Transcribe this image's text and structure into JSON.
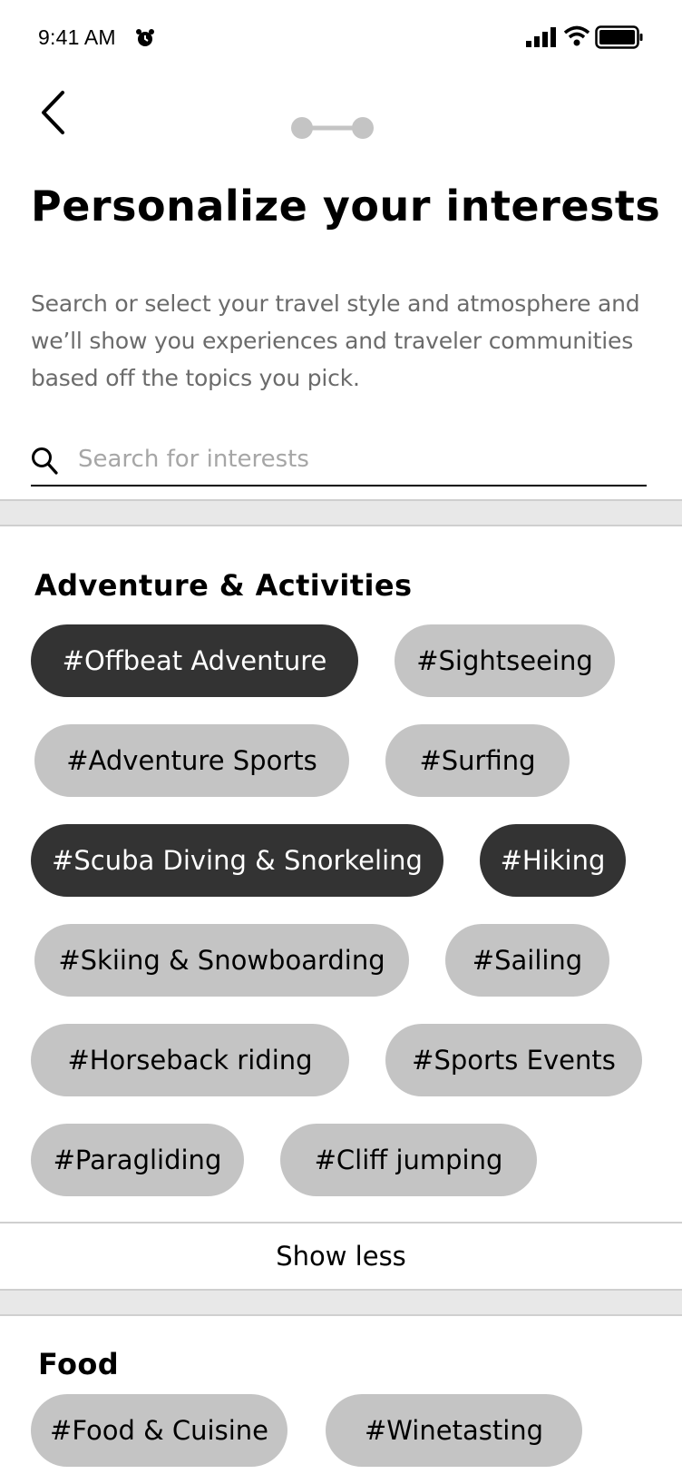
{
  "status_bar": {
    "time": "9:41 AM",
    "icons": [
      "alarm-icon",
      "signal-icon",
      "wifi-icon",
      "battery-icon"
    ]
  },
  "nav": {
    "back_icon": "chevron-left-icon",
    "progress_steps": 2
  },
  "header": {
    "title": "Personalize your interests",
    "description": "Search or select your travel style and atmosphere and we’ll show you experiences and traveler communities based off the topics you pick."
  },
  "search": {
    "placeholder": "Search for interests",
    "value": ""
  },
  "sections": [
    {
      "title": "Adventure & Activities",
      "chips": [
        {
          "label": "#Offbeat Adventure",
          "selected": true
        },
        {
          "label": "#Sightseeing",
          "selected": false
        },
        {
          "label": "#Adventure Sports",
          "selected": false
        },
        {
          "label": "#Surfing",
          "selected": false
        },
        {
          "label": "#Scuba Diving & Snorkeling",
          "selected": true
        },
        {
          "label": "#Hiking",
          "selected": true
        },
        {
          "label": "#Skiing & Snowboarding",
          "selected": false
        },
        {
          "label": "#Sailing",
          "selected": false
        },
        {
          "label": "#Horseback riding",
          "selected": false
        },
        {
          "label": "#Sports Events",
          "selected": false
        },
        {
          "label": "#Paragliding",
          "selected": false
        },
        {
          "label": "#Cliff jumping",
          "selected": false
        }
      ],
      "toggle_label": "Show less"
    },
    {
      "title": "Food",
      "chips": [
        {
          "label": "#Food & Cuisine",
          "selected": false
        },
        {
          "label": "#Winetasting",
          "selected": false
        }
      ]
    }
  ],
  "colors": {
    "chip_default": "#c4c4c4",
    "chip_selected": "#333333",
    "description_text": "#6b6b6b",
    "divider": "#e8e8e8"
  }
}
